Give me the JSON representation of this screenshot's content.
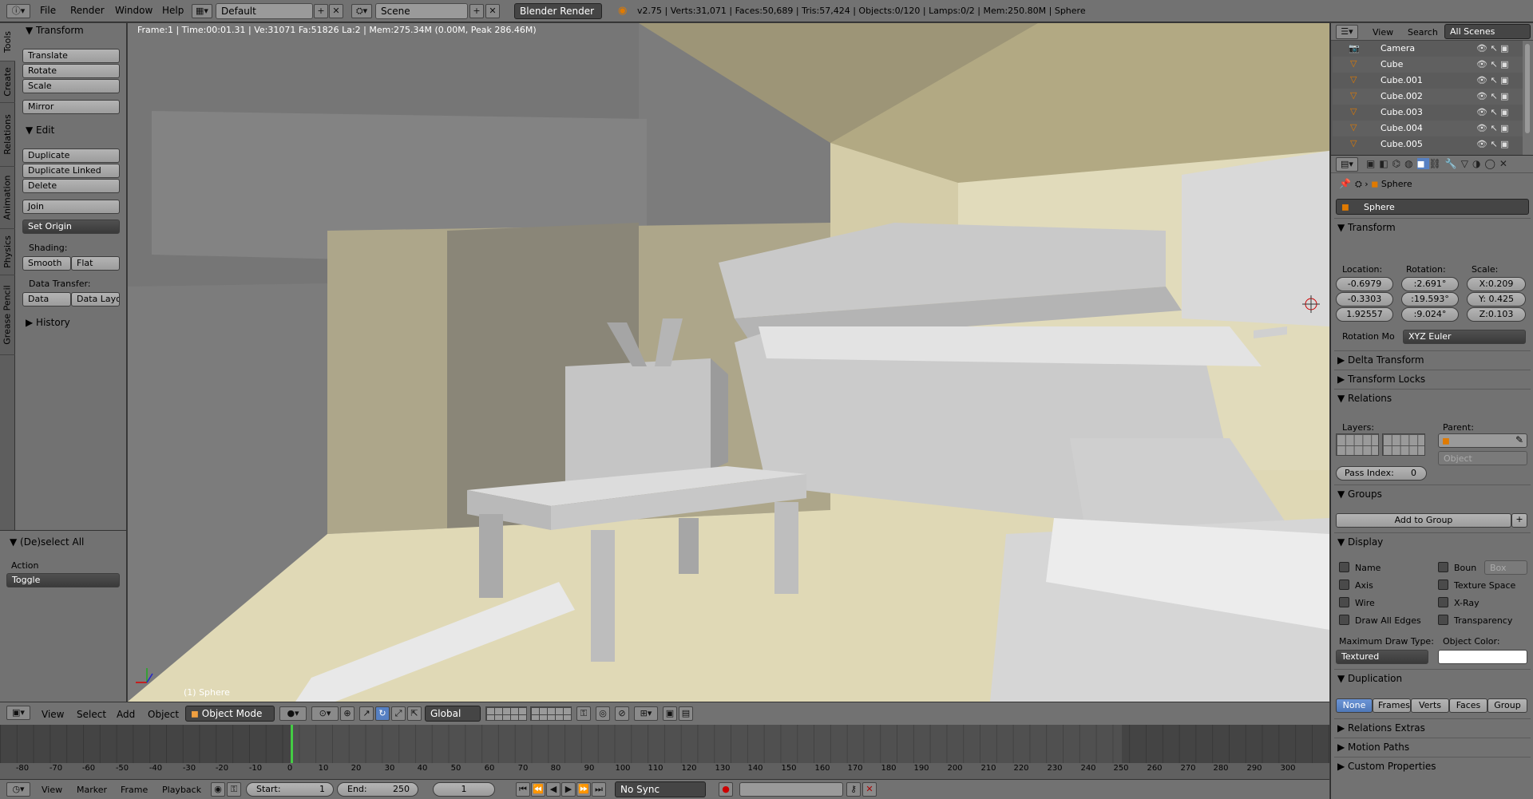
{
  "topbar": {
    "menus": [
      "File",
      "Render",
      "Window",
      "Help"
    ],
    "layout": "Default",
    "scene": "Scene",
    "engine": "Blender Render",
    "stats": "v2.75 | Verts:31,071 | Faces:50,689 | Tris:57,424 | Objects:0/120 | Lamps:0/2 | Mem:250.80M | Sphere"
  },
  "vtabs": [
    "Tools",
    "Create",
    "Relations",
    "Animation",
    "Physics",
    "Grease Pencil"
  ],
  "toolshelf": {
    "transform_title": "Transform",
    "translate": "Translate",
    "rotate": "Rotate",
    "scale": "Scale",
    "mirror": "Mirror",
    "edit_title": "Edit",
    "duplicate": "Duplicate",
    "duplicate_linked": "Duplicate Linked",
    "delete": "Delete",
    "join": "Join",
    "set_origin": "Set Origin",
    "shading_label": "Shading:",
    "smooth": "Smooth",
    "flat": "Flat",
    "data_transfer_label": "Data Transfer:",
    "data": "Data",
    "data_layout": "Data Layo",
    "history_title": "History",
    "operator_title": "(De)select All",
    "action_label": "Action",
    "action_value": "Toggle"
  },
  "viewport": {
    "info": "Frame:1 | Time:00:01.31 | Ve:31071 Fa:51826 La:2 | Mem:275.34M (0.00M, Peak 286.46M)",
    "object_label": "(1) Sphere"
  },
  "vpheader": {
    "view": "View",
    "select": "Select",
    "add": "Add",
    "object": "Object",
    "mode": "Object Mode",
    "orientation": "Global"
  },
  "timeline": {
    "ticks": [
      "-80",
      "-70",
      "-60",
      "-50",
      "-40",
      "-30",
      "-20",
      "-10",
      "0",
      "10",
      "20",
      "30",
      "40",
      "50",
      "60",
      "70",
      "80",
      "90",
      "100",
      "110",
      "120",
      "130",
      "140",
      "150",
      "160",
      "170",
      "180",
      "190",
      "200",
      "210",
      "220",
      "230",
      "240",
      "250",
      "260",
      "270",
      "280",
      "290",
      "300"
    ],
    "view": "View",
    "marker": "Marker",
    "frame": "Frame",
    "playback": "Playback",
    "start_label": "Start:",
    "start": "1",
    "end_label": "End:",
    "end": "250",
    "current": "1",
    "sync": "No Sync"
  },
  "outliner": {
    "view": "View",
    "search": "Search",
    "scenes": "All Scenes",
    "items": [
      "Camera",
      "Cube",
      "Cube.001",
      "Cube.002",
      "Cube.003",
      "Cube.004",
      "Cube.005"
    ]
  },
  "props": {
    "breadcrumb": "Sphere",
    "name": "Sphere",
    "transform_title": "Transform",
    "location_label": "Location:",
    "rotation_label": "Rotation:",
    "scale_label": "Scale:",
    "loc": [
      "-0.6979",
      "-0.3303",
      "1.92557"
    ],
    "rot": [
      ":2.691°",
      ":19.593°",
      ":9.024°"
    ],
    "scl": [
      "X:0.209",
      "Y: 0.425",
      "Z:0.103"
    ],
    "rotation_mode_label": "Rotation Mo",
    "rotation_mode": "XYZ Euler",
    "delta": "Delta Transform",
    "locks": "Transform Locks",
    "relations_title": "Relations",
    "layers_label": "Layers:",
    "parent_label": "Parent:",
    "parent_type": "Object",
    "pass_index_label": "Pass Index:",
    "pass_index": "0",
    "groups_title": "Groups",
    "add_to_group": "Add to Group",
    "display_title": "Display",
    "name_chk": "Name",
    "bounds_chk": "Boun",
    "bounds_type": "Box",
    "axis_chk": "Axis",
    "texspace_chk": "Texture Space",
    "wire_chk": "Wire",
    "xray_chk": "X-Ray",
    "alledges_chk": "Draw All Edges",
    "transparency_chk": "Transparency",
    "max_draw_label": "Maximum Draw Type:",
    "obj_color_label": "Object Color:",
    "max_draw": "Textured",
    "duplication_title": "Duplication",
    "dup": [
      "None",
      "Frames",
      "Verts",
      "Faces",
      "Group"
    ],
    "relations_extras": "Relations Extras",
    "motion_paths": "Motion Paths",
    "custom_props": "Custom Properties"
  }
}
